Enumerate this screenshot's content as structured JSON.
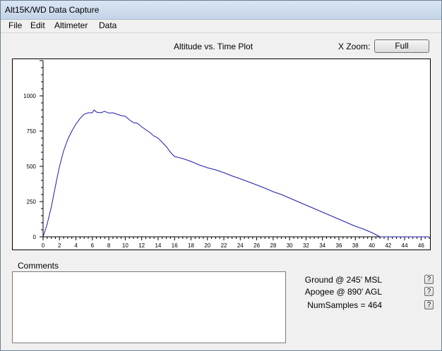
{
  "window": {
    "title": "Alt15K/WD Data Capture"
  },
  "menu": [
    "File",
    "Edit",
    "Altimeter",
    "Data"
  ],
  "plot": {
    "title": "Altitude vs. Time Plot",
    "xzoom_label": "X Zoom:",
    "zoom_button": "Full"
  },
  "chart_data": {
    "type": "line",
    "title": "Altitude vs. Time Plot",
    "xlabel": "",
    "ylabel": "",
    "xlim": [
      0,
      47
    ],
    "ylim": [
      0,
      1250
    ],
    "xticks": [
      0,
      2,
      4,
      6,
      8,
      10,
      12,
      14,
      16,
      18,
      20,
      22,
      24,
      26,
      28,
      30,
      32,
      34,
      36,
      38,
      40,
      42,
      44,
      46
    ],
    "yticks": [
      0,
      250,
      500,
      750,
      1000
    ],
    "color": "#1c1ca8",
    "series": [
      {
        "x": [
          0,
          0.5,
          1,
          1.5,
          2,
          2.5,
          3,
          3.5,
          4,
          4.5,
          5,
          5.5,
          6,
          6.2,
          6.5,
          7,
          7.5,
          8,
          8.5,
          9,
          9.5,
          10,
          10.5,
          11,
          11.5,
          12,
          12.5,
          13,
          13.5,
          14,
          14.5,
          15,
          15.5,
          16,
          17,
          18,
          19,
          20,
          21,
          22,
          23,
          24,
          25,
          26,
          27,
          28,
          29,
          30,
          31,
          32,
          33,
          34,
          35,
          36,
          37,
          38,
          39,
          40,
          40.5,
          41,
          42,
          43,
          44,
          45,
          46,
          47
        ],
        "y": [
          0,
          90,
          210,
          360,
          500,
          610,
          690,
          750,
          800,
          840,
          870,
          880,
          880,
          900,
          885,
          880,
          890,
          878,
          880,
          870,
          860,
          855,
          830,
          810,
          805,
          780,
          760,
          740,
          715,
          700,
          670,
          640,
          600,
          570,
          555,
          535,
          510,
          490,
          475,
          455,
          432,
          412,
          390,
          368,
          345,
          320,
          300,
          275,
          250,
          225,
          200,
          175,
          150,
          125,
          100,
          75,
          55,
          30,
          15,
          0,
          0,
          0,
          0,
          0,
          0,
          0
        ]
      }
    ]
  },
  "comments": {
    "label": "Comments",
    "text": ""
  },
  "stats": {
    "ground": "Ground @  245' MSL",
    "apogee": "Apogee @  890' AGL",
    "samples": "NumSamples =  464"
  },
  "help_label": "?"
}
